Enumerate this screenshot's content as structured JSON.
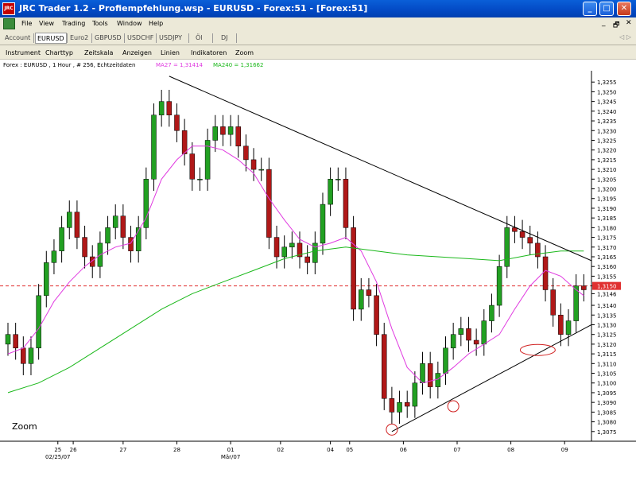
{
  "window": {
    "title": "JRC Trader 1.2 - Profiempfehlung.wsp - EURUSD - Forex:51 - [Forex:51]",
    "app_icon_text": "JRC",
    "minimize_glyph": "_",
    "maximize_glyph": "□",
    "close_glyph": "✕"
  },
  "menubar": {
    "items": [
      "File",
      "View",
      "Trading",
      "Tools",
      "Window",
      "Help"
    ],
    "controls": [
      "_",
      "🗗",
      "✕"
    ]
  },
  "tabs": {
    "items": [
      "Account",
      "EURUSD",
      "Euro2",
      "GBPUSD",
      "USDCHF",
      "USDJPY",
      "Öl",
      "DJ"
    ],
    "active": "EURUSD",
    "arrows": "◁ ▷"
  },
  "chart_menu": {
    "items": [
      "Instrument",
      "Charttyp",
      "Zeitskala",
      "Anzeigen",
      "Linien",
      "Indikatoren",
      "Zoom"
    ]
  },
  "infobar": {
    "instrument": "Forex : EURUSD , 1 Hour , # 256, Echtzeitdaten",
    "ma27": "MA27 = 1,31414",
    "ma240": "MA240 = 1,31662",
    "ma27_color": "#e03ae0",
    "ma240_color": "#1ab81a"
  },
  "zoom_label": "Zoom",
  "chart_data": {
    "type": "line",
    "title": "",
    "ylabel": "",
    "xlabel": "",
    "ylim": [
      1.307,
      1.326
    ],
    "y_ticks": [
      "1,3075",
      "1,3080",
      "1,3085",
      "1,3090",
      "1,3095",
      "1,3100",
      "1,3105",
      "1,3110",
      "1,3115",
      "1,3120",
      "1,3125",
      "1,3130",
      "1,3135",
      "1,3140",
      "1,3146",
      "1,3150",
      "1,3155",
      "1,3160",
      "1,3165",
      "1,3170",
      "1,3175",
      "1,3180",
      "1,3185",
      "1,3190",
      "1,3195",
      "1,3200",
      "1,3205",
      "1,3210",
      "1,3215",
      "1,3220",
      "1,3225",
      "1,3230",
      "1,3235",
      "1,3240",
      "1,3245",
      "1,3250",
      "1,3255"
    ],
    "y_tick_values": [
      1.3075,
      1.308,
      1.3085,
      1.309,
      1.3095,
      1.31,
      1.3105,
      1.311,
      1.3115,
      1.312,
      1.3125,
      1.313,
      1.3135,
      1.314,
      1.3146,
      1.315,
      1.3155,
      1.316,
      1.3165,
      1.317,
      1.3175,
      1.318,
      1.3185,
      1.319,
      1.3195,
      1.32,
      1.3205,
      1.321,
      1.3215,
      1.322,
      1.3225,
      1.323,
      1.3235,
      1.324,
      1.3245,
      1.325,
      1.3255
    ],
    "x_ticks": [
      {
        "label": "25",
        "sub": "02/25/07",
        "pos": 6.5
      },
      {
        "label": "26",
        "sub": "",
        "pos": 8.5
      },
      {
        "label": "27",
        "sub": "",
        "pos": 15
      },
      {
        "label": "28",
        "sub": "",
        "pos": 22
      },
      {
        "label": "01",
        "sub": "Mär/07",
        "pos": 29
      },
      {
        "label": "02",
        "sub": "",
        "pos": 35.5
      },
      {
        "label": "04",
        "sub": "",
        "pos": 42
      },
      {
        "label": "05",
        "sub": "",
        "pos": 44.5
      },
      {
        "label": "06",
        "sub": "",
        "pos": 51.5
      },
      {
        "label": "07",
        "sub": "",
        "pos": 58.5
      },
      {
        "label": "08",
        "sub": "",
        "pos": 65.5
      },
      {
        "label": "09",
        "sub": "",
        "pos": 72.5
      }
    ],
    "x_range": [
      0,
      76
    ],
    "series": [
      {
        "name": "EURUSD Close",
        "points": [
          [
            0,
            1.3125
          ],
          [
            1,
            1.3118
          ],
          [
            2,
            1.311
          ],
          [
            3,
            1.3118
          ],
          [
            4,
            1.3145
          ],
          [
            5,
            1.3162
          ],
          [
            6,
            1.3168
          ],
          [
            7,
            1.318
          ],
          [
            8,
            1.3188
          ],
          [
            9,
            1.3175
          ],
          [
            10,
            1.3165
          ],
          [
            11,
            1.316
          ],
          [
            12,
            1.3172
          ],
          [
            13,
            1.318
          ],
          [
            14,
            1.3186
          ],
          [
            15,
            1.3175
          ],
          [
            16,
            1.3168
          ],
          [
            17,
            1.318
          ],
          [
            18,
            1.3205
          ],
          [
            19,
            1.3238
          ],
          [
            20,
            1.3245
          ],
          [
            21,
            1.3238
          ],
          [
            22,
            1.323
          ],
          [
            23,
            1.3218
          ],
          [
            24,
            1.3205
          ],
          [
            25,
            1.3205
          ],
          [
            26,
            1.3225
          ],
          [
            27,
            1.3232
          ],
          [
            28,
            1.3228
          ],
          [
            29,
            1.3232
          ],
          [
            30,
            1.3222
          ],
          [
            31,
            1.3215
          ],
          [
            32,
            1.321
          ],
          [
            33,
            1.321
          ],
          [
            34,
            1.3175
          ],
          [
            35,
            1.3165
          ],
          [
            36,
            1.317
          ],
          [
            37,
            1.3172
          ],
          [
            38,
            1.3165
          ],
          [
            39,
            1.3162
          ],
          [
            40,
            1.3172
          ],
          [
            41,
            1.3192
          ],
          [
            42,
            1.3205
          ],
          [
            43,
            1.3205
          ],
          [
            44,
            1.318
          ],
          [
            45,
            1.3138
          ],
          [
            46,
            1.3148
          ],
          [
            47,
            1.3145
          ],
          [
            48,
            1.3125
          ],
          [
            49,
            1.3092
          ],
          [
            50,
            1.3085
          ],
          [
            51,
            1.309
          ],
          [
            52,
            1.3088
          ],
          [
            53,
            1.31
          ],
          [
            54,
            1.311
          ],
          [
            55,
            1.3098
          ],
          [
            56,
            1.3105
          ],
          [
            57,
            1.3118
          ],
          [
            58,
            1.3125
          ],
          [
            59,
            1.3128
          ],
          [
            60,
            1.3122
          ],
          [
            61,
            1.312
          ],
          [
            62,
            1.3132
          ],
          [
            63,
            1.314
          ],
          [
            64,
            1.316
          ],
          [
            65,
            1.318
          ],
          [
            66,
            1.3178
          ],
          [
            67,
            1.3175
          ],
          [
            68,
            1.3172
          ],
          [
            69,
            1.3165
          ],
          [
            70,
            1.3148
          ],
          [
            71,
            1.3135
          ],
          [
            72,
            1.3125
          ],
          [
            73,
            1.3132
          ],
          [
            74,
            1.315
          ],
          [
            75,
            1.3148
          ]
        ]
      },
      {
        "name": "MA27",
        "points": [
          [
            0,
            1.3115
          ],
          [
            2,
            1.3118
          ],
          [
            4,
            1.3128
          ],
          [
            6,
            1.3142
          ],
          [
            8,
            1.3152
          ],
          [
            10,
            1.316
          ],
          [
            12,
            1.3166
          ],
          [
            14,
            1.317
          ],
          [
            16,
            1.3172
          ],
          [
            18,
            1.3185
          ],
          [
            20,
            1.3205
          ],
          [
            22,
            1.3215
          ],
          [
            24,
            1.3222
          ],
          [
            26,
            1.3222
          ],
          [
            28,
            1.322
          ],
          [
            30,
            1.3215
          ],
          [
            32,
            1.3208
          ],
          [
            34,
            1.3195
          ],
          [
            36,
            1.3184
          ],
          [
            38,
            1.3174
          ],
          [
            40,
            1.317
          ],
          [
            42,
            1.3172
          ],
          [
            44,
            1.3175
          ],
          [
            46,
            1.3168
          ],
          [
            48,
            1.3152
          ],
          [
            50,
            1.3128
          ],
          [
            52,
            1.3108
          ],
          [
            54,
            1.31
          ],
          [
            56,
            1.3102
          ],
          [
            58,
            1.3108
          ],
          [
            60,
            1.3115
          ],
          [
            62,
            1.312
          ],
          [
            64,
            1.3125
          ],
          [
            66,
            1.3138
          ],
          [
            68,
            1.315
          ],
          [
            70,
            1.3158
          ],
          [
            72,
            1.3155
          ],
          [
            74,
            1.3148
          ],
          [
            75,
            1.3145
          ]
        ]
      },
      {
        "name": "MA240",
        "points": [
          [
            0,
            1.3095
          ],
          [
            4,
            1.31
          ],
          [
            8,
            1.3108
          ],
          [
            12,
            1.3118
          ],
          [
            16,
            1.3128
          ],
          [
            20,
            1.3138
          ],
          [
            24,
            1.3146
          ],
          [
            28,
            1.3152
          ],
          [
            32,
            1.3158
          ],
          [
            36,
            1.3164
          ],
          [
            40,
            1.3168
          ],
          [
            44,
            1.317
          ],
          [
            48,
            1.3168
          ],
          [
            52,
            1.3166
          ],
          [
            56,
            1.3165
          ],
          [
            60,
            1.3164
          ],
          [
            64,
            1.3163
          ],
          [
            68,
            1.3166
          ],
          [
            72,
            1.3168
          ],
          [
            75,
            1.3168
          ]
        ]
      }
    ],
    "reference_line": {
      "value": 1.315,
      "color": "#e03030"
    },
    "trend_lines": [
      {
        "from": [
          21,
          1.3258
        ],
        "to": [
          76,
          1.3163
        ]
      },
      {
        "from": [
          50,
          1.3075
        ],
        "to": [
          76,
          1.313
        ]
      }
    ],
    "circled_lows": [
      [
        50,
        1.3076
      ],
      [
        58,
        1.3088
      ],
      [
        69,
        1.3117
      ]
    ],
    "grid": false,
    "legend": "none"
  }
}
